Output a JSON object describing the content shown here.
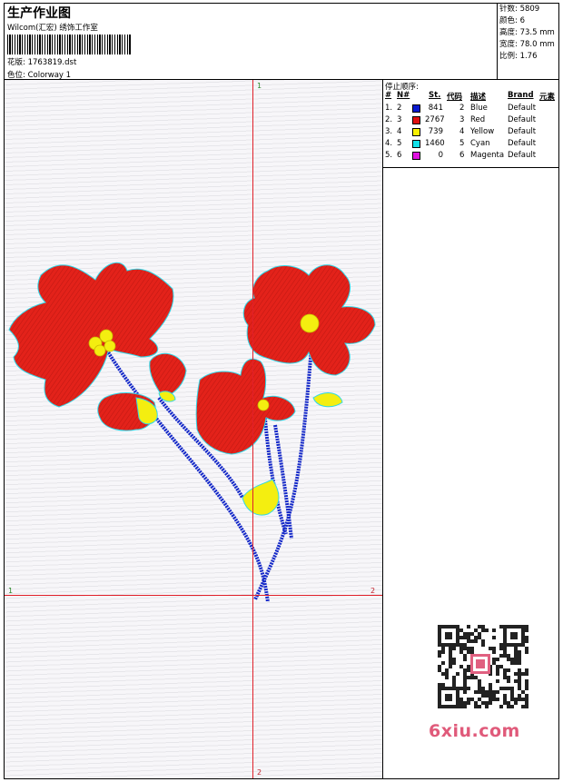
{
  "header": {
    "title": "生产作业图",
    "subtitle": "Wilcom(汇宏) 绣饰工作室",
    "design_label": "花版: 1763819.dst",
    "colorway_label": "色位: Colorway 1"
  },
  "stats": {
    "stitches": "针数: 5809",
    "colors": "颜色: 6",
    "height": "高度: 73.5 mm",
    "width": "宽度: 78.0 mm",
    "scale": "比例: 1.76"
  },
  "stop_sequence": {
    "title": "停止顺序:",
    "headers": [
      "#",
      "N#",
      "St.",
      "代码",
      "描述",
      "Brand",
      "元素"
    ],
    "rows": [
      {
        "idx": "1.",
        "n": "2",
        "st": "841",
        "code": "2",
        "desc": "Blue",
        "brand": "Default",
        "color": "#0a1ad0"
      },
      {
        "idx": "2.",
        "n": "3",
        "st": "2767",
        "code": "3",
        "desc": "Red",
        "brand": "Default",
        "color": "#e01010"
      },
      {
        "idx": "3.",
        "n": "4",
        "st": "739",
        "code": "4",
        "desc": "Yellow",
        "brand": "Default",
        "color": "#f8f000"
      },
      {
        "idx": "4.",
        "n": "5",
        "st": "1460",
        "code": "5",
        "desc": "Cyan",
        "brand": "Default",
        "color": "#10e0e8"
      },
      {
        "idx": "5.",
        "n": "6",
        "st": "0",
        "code": "6",
        "desc": "Magenta",
        "brand": "Default",
        "color": "#e010e0"
      }
    ]
  },
  "guides": {
    "top": "1",
    "left": "1",
    "right": "2",
    "bottom": "2"
  },
  "watermark": {
    "brand": "6xiu.com"
  },
  "colors": {
    "guide": "#e0202a",
    "stem": "#1428c8",
    "petal": "#e0201a",
    "center": "#f4ee10",
    "outline": "#30d8e8"
  }
}
